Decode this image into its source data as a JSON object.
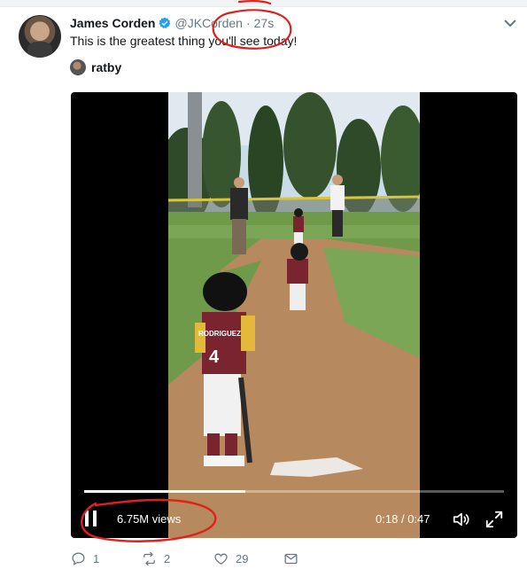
{
  "tweet": {
    "author_name": "James Corden",
    "handle": "@JKCorden",
    "separator": "·",
    "time": "27s",
    "text": "This is the greatest thing you'll see today!",
    "attribution": "ratby"
  },
  "video": {
    "views": "6.75M views",
    "time_current": "0:18",
    "time_separator": "/",
    "time_total": "0:47",
    "progress_fraction": 0.383,
    "player_number": "4",
    "jersey_text": "RODRIGUEZ"
  },
  "actions": {
    "reply_count": "1",
    "retweet_count": "2",
    "like_count": "29"
  },
  "colors": {
    "verified": "#1da1f2",
    "secondary_text": "#657786",
    "annotation": "#e0211b"
  },
  "icons": [
    "verified-badge-icon",
    "chevron-down-icon",
    "pause-icon",
    "volume-icon",
    "fullscreen-icon",
    "reply-icon",
    "retweet-icon",
    "like-icon",
    "message-icon"
  ]
}
